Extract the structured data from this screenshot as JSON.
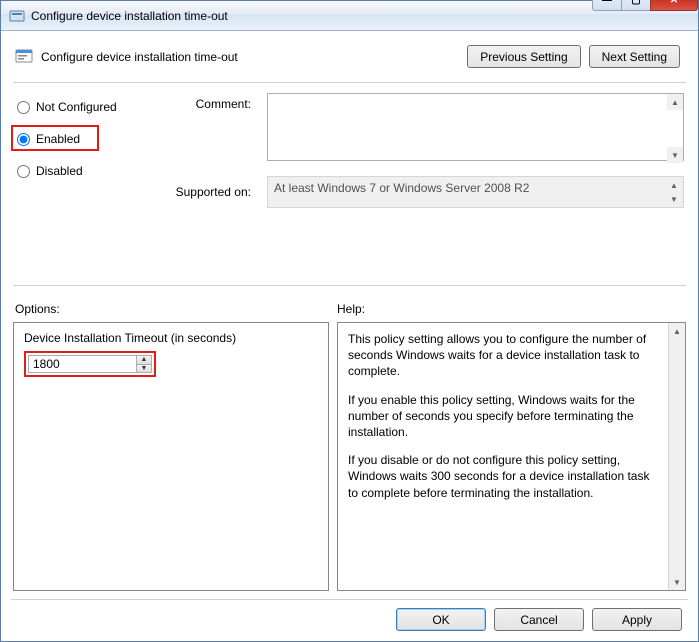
{
  "window": {
    "title": "Configure device installation time-out"
  },
  "header": {
    "title": "Configure device installation time-out",
    "prev_btn": "Previous Setting",
    "next_btn": "Next Setting"
  },
  "radios": {
    "not_configured": "Not Configured",
    "enabled": "Enabled",
    "disabled": "Disabled",
    "selected": "enabled"
  },
  "labels": {
    "comment": "Comment:",
    "supported": "Supported on:",
    "options": "Options:",
    "help": "Help:"
  },
  "comment_value": "",
  "supported_text": "At least Windows 7 or Windows Server 2008 R2",
  "options": {
    "timeout_label": "Device Installation Timeout (in seconds)",
    "timeout_value": "1800"
  },
  "help": {
    "p1": "This policy setting allows you to configure the number of seconds Windows waits for a device installation task to complete.",
    "p2": "If you enable this policy setting, Windows waits for the number of seconds you specify before terminating the installation.",
    "p3": "If you disable or do not configure this policy setting, Windows waits 300 seconds for a device installation task to complete before terminating the installation."
  },
  "footer": {
    "ok": "OK",
    "cancel": "Cancel",
    "apply": "Apply"
  }
}
